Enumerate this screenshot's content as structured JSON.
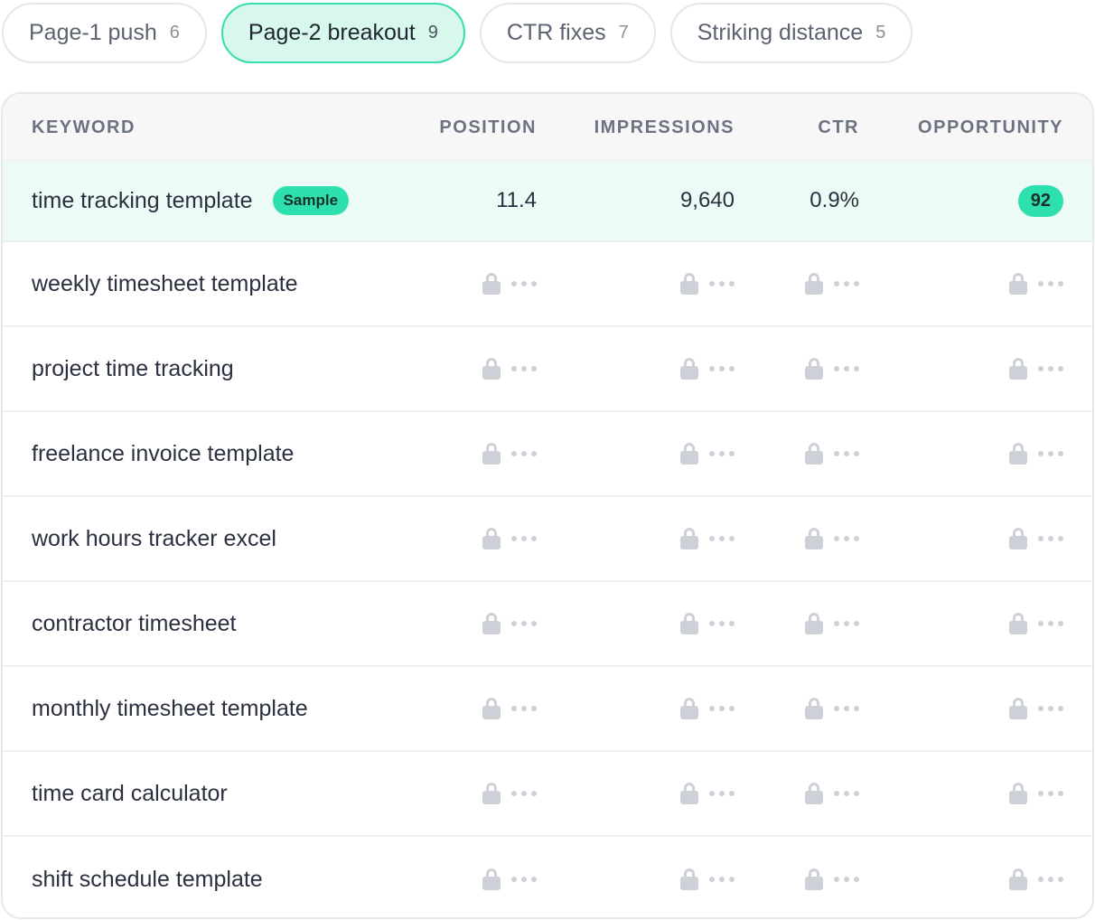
{
  "tabs": [
    {
      "label": "Page-1 push",
      "count": "6",
      "active": false
    },
    {
      "label": "Page-2 breakout",
      "count": "9",
      "active": true
    },
    {
      "label": "CTR fixes",
      "count": "7",
      "active": false
    },
    {
      "label": "Striking distance",
      "count": "5",
      "active": false
    }
  ],
  "table": {
    "headers": {
      "keyword": "KEYWORD",
      "position": "POSITION",
      "impressions": "IMPRESSIONS",
      "ctr": "CTR",
      "opportunity": "OPPORTUNITY"
    },
    "sample_row": {
      "keyword": "time tracking template",
      "badge": "Sample",
      "position": "11.4",
      "impressions": "9,640",
      "ctr": "0.9%",
      "opportunity": "92"
    },
    "locked_rows": [
      "weekly timesheet template",
      "project time tracking",
      "freelance invoice template",
      "work hours tracker excel",
      "contractor timesheet",
      "monthly timesheet template",
      "time card calculator",
      "shift schedule template"
    ]
  },
  "colors": {
    "accent": "#2ee0ad",
    "active_tab_bg": "#d8f8ed",
    "sample_row_bg": "#ecfbf6",
    "locked_icon": "#cdd1d7"
  },
  "icons": {
    "locked_value": "lock-icon",
    "hidden_value": "ellipsis-icon"
  }
}
